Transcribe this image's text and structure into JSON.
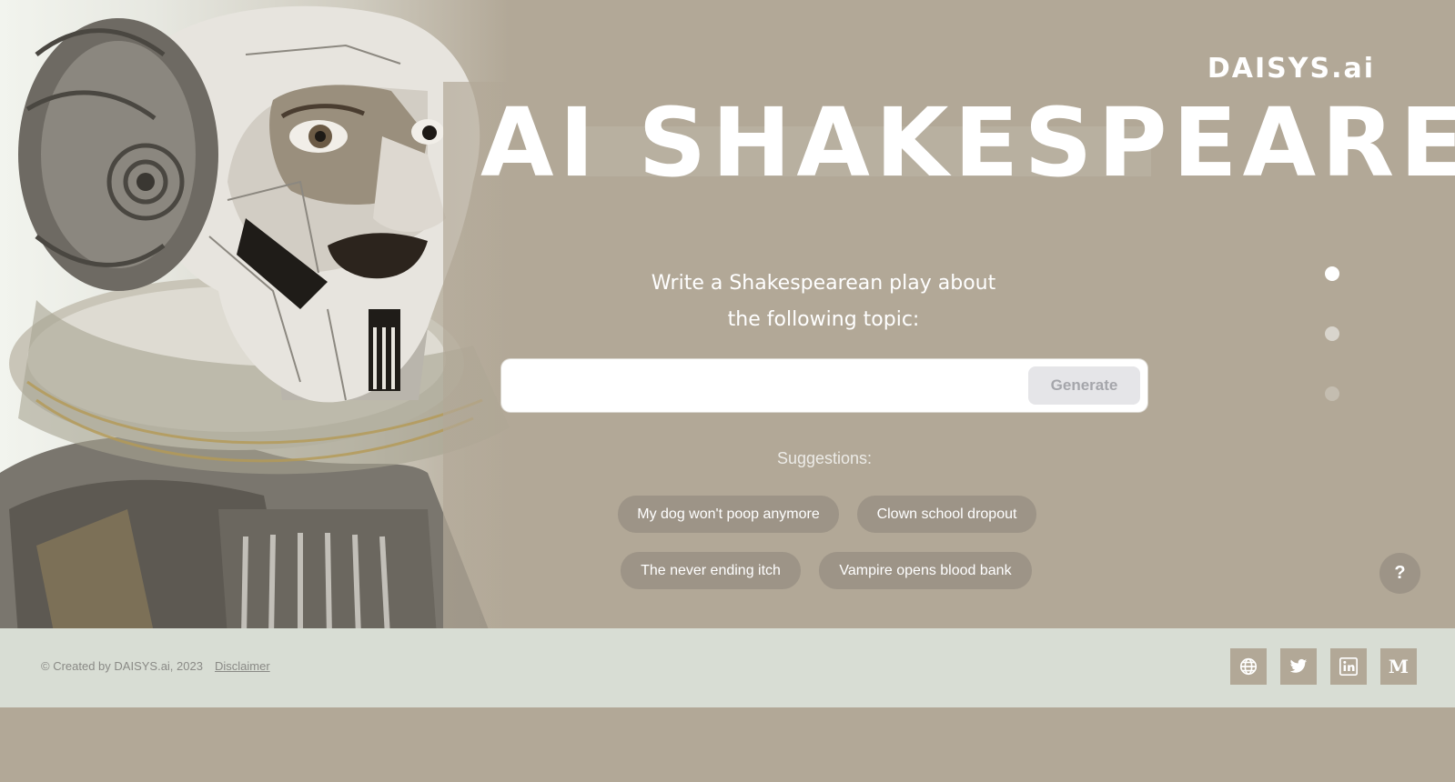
{
  "brand": {
    "logo": "DAISYS.ai"
  },
  "hero": {
    "title": "AI SHAKESPEARE",
    "prompt_line1": "Write a Shakespearean play about",
    "prompt_line2": "the following topic:"
  },
  "form": {
    "input_value": "",
    "input_placeholder": "",
    "generate_label": "Generate"
  },
  "suggestions": {
    "label": "Suggestions:",
    "items": [
      "My dog won't poop anymore",
      "Clown school dropout",
      "The never ending itch",
      "Vampire opens blood bank"
    ]
  },
  "pager": {
    "count": 3,
    "active_index": 0
  },
  "help": {
    "label": "?"
  },
  "footer": {
    "copyright": "© Created by DAISYS.ai, 2023",
    "disclaimer": "Disclaimer",
    "social": [
      {
        "icon": "globe-icon"
      },
      {
        "icon": "twitter-icon"
      },
      {
        "icon": "linkedin-icon"
      },
      {
        "icon": "medium-icon",
        "glyph": "M"
      }
    ]
  },
  "colors": {
    "background": "#b2a897",
    "footer": "#d8ddd4",
    "chip": "#9d9487",
    "text_on_bg": "#ffffff"
  }
}
